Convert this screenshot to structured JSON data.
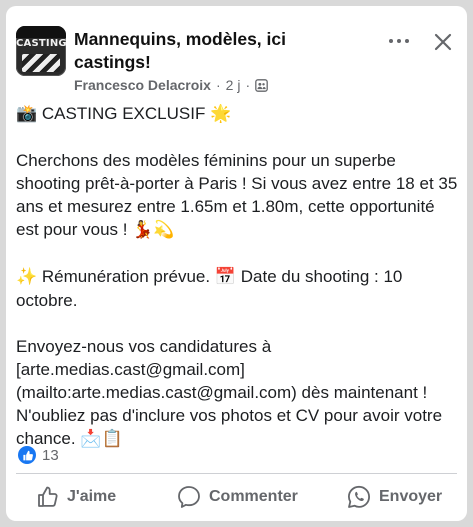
{
  "post": {
    "group_title": "Mannequins, modèles, ici castings!",
    "avatar_text": "CASTING",
    "author": "Francesco Delacroix",
    "separator": "·",
    "time": "2 j",
    "separator2": "·",
    "body": {
      "line1_emoji_left": "📸",
      "line1_text": "CASTING EXCLUSIF",
      "line1_emoji_right": "🌟",
      "para2": "Cherchons des modèles féminins pour un superbe shooting prêt-à-porter à Paris ! Si vous avez entre 18 et 35 ans et mesurez entre 1.65m et 1.80m, cette opportunité est pour vous !",
      "para2_emojis": "💃💫",
      "para3_emoji1": "✨",
      "para3_text1": "Rémunération prévue.",
      "para3_emoji2": "📅",
      "para3_text2": "Date du shooting : 10 octobre.",
      "para4": "Envoyez-nous vos candidatures à [arte.medias.cast@gmail.com](mailto:arte.medias.cast@gmail.com) dès maintenant ! N'oubliez pas d'inclure vos photos et CV pour avoir votre chance.",
      "para4_emojis": "📩📋"
    },
    "reaction_count": "13"
  },
  "actions": {
    "like": "J'aime",
    "comment": "Commenter",
    "share": "Envoyer"
  },
  "icons": {
    "more": "more-horizontal-icon",
    "close": "close-icon",
    "group": "group-icon",
    "like": "thumbs-up-icon",
    "comment": "comment-bubble-icon",
    "share": "whatsapp-icon"
  },
  "colors": {
    "accent": "#1877f2",
    "secondary_text": "#65676b",
    "primary_text": "#1c1e21"
  }
}
